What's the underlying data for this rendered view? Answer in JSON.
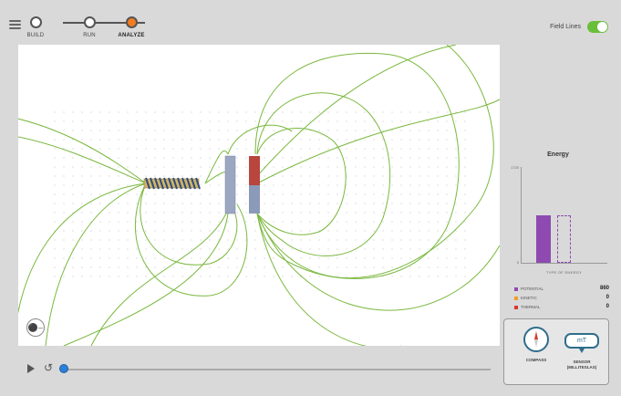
{
  "nav": {
    "steps": [
      {
        "label": "BUILD"
      },
      {
        "label": "RUN"
      },
      {
        "label": "ANALYZE"
      }
    ],
    "active_step": "ANALYZE"
  },
  "field_lines": {
    "label": "Field Lines",
    "enabled": true
  },
  "timeline": {
    "progress": 0
  },
  "energy": {
    "title": "Energy",
    "y_max": "1720",
    "y_min": "0",
    "x_label": "TYPE OF ENERGY",
    "legend": [
      {
        "name": "POTENTIAL",
        "value": "860",
        "color": "#8e4ab0"
      },
      {
        "name": "KINETIC",
        "value": "0",
        "color": "#f29b2b"
      },
      {
        "name": "THERMAL",
        "value": "0",
        "color": "#d63a2f"
      }
    ]
  },
  "chart_data": {
    "type": "bar",
    "title": "Energy",
    "xlabel": "TYPE OF ENERGY",
    "ylim": [
      0,
      1720
    ],
    "categories": [
      "POTENTIAL",
      "KINETIC"
    ],
    "values": [
      860,
      860
    ]
  },
  "tools": {
    "compass_label": "COMPASS",
    "sensor_label_1": "SENSOR",
    "sensor_label_2": "(MILLITESLAS)",
    "sensor_unit": "mT"
  },
  "colors": {
    "accent": "#f47b20",
    "field_line": "#7ab83e",
    "toggle": "#6abf3a"
  }
}
